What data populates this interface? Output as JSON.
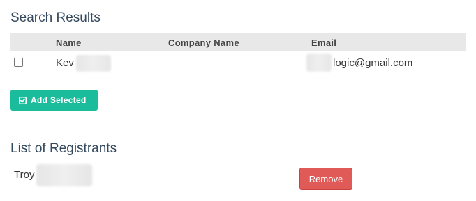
{
  "search_results": {
    "title": "Search Results",
    "columns": {
      "name": "Name",
      "company": "Company Name",
      "email": "Email"
    },
    "rows": [
      {
        "name": "Kev",
        "company": "",
        "email": "logic@gmail.com",
        "checked": false
      }
    ],
    "add_button_label": "Add Selected",
    "add_button_icon": "check-square-icon",
    "accent_color": "#1abc9c"
  },
  "registrants": {
    "title": "List of Registrants",
    "items": [
      {
        "name": "Troy",
        "remove_label": "Remove"
      }
    ],
    "remove_color": "#e05a57"
  }
}
